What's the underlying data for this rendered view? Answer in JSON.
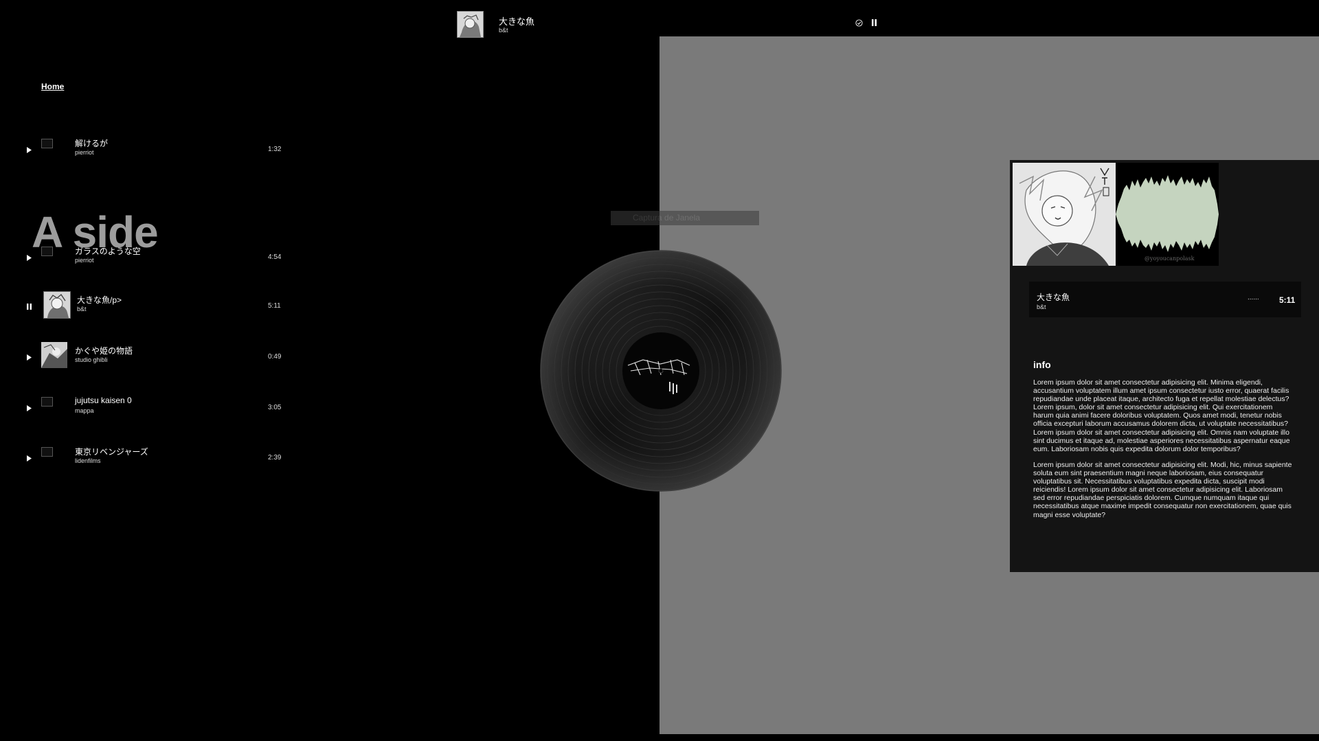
{
  "now_playing": {
    "title": "大きな魚",
    "artist": "b&t",
    "time": "5:11",
    "dots": "......"
  },
  "nav": {
    "home": "Home"
  },
  "side_heading": "A side",
  "tracks": [
    {
      "title": "解けるが",
      "artist": "pierriot",
      "duration": "1:32",
      "state": "paused",
      "cover": "broken"
    },
    {
      "title": "ガラスのような空",
      "artist": "pierriot",
      "duration": "4:54",
      "state": "paused",
      "cover": "broken"
    },
    {
      "title": "大きな魚/p>",
      "artist": "b&t",
      "duration": "5:11",
      "state": "playing",
      "cover": "sketch"
    },
    {
      "title": "かぐや姫の物語",
      "artist": "studio ghibli",
      "duration": "0:49",
      "state": "paused",
      "cover": "sketch"
    },
    {
      "title": "jujutsu kaisen 0",
      "artist": "mappa",
      "duration": "3:05",
      "state": "paused",
      "cover": "broken"
    },
    {
      "title": "東京リベンジャーズ",
      "artist": "lidenfilms",
      "duration": "2:39",
      "state": "paused",
      "cover": "broken"
    }
  ],
  "overlay": {
    "label": "Captura de Janela"
  },
  "panel": {
    "wave_caption": "@yoyoucanpolask",
    "info_heading": "info",
    "paragraphs": [
      "Lorem ipsum dolor sit amet consectetur adipisicing elit. Minima eligendi, accusantium voluptatem illum amet ipsum consectetur iusto error, quaerat facilis repudiandae unde placeat itaque, architecto fuga et repellat molestiae delectus? Lorem ipsum, dolor sit amet consectetur adipisicing elit. Qui exercitationem harum quia animi facere doloribus voluptatem. Quos amet modi, tenetur nobis officia excepturi laborum accusamus dolorem dicta, ut voluptate necessitatibus? Lorem ipsum dolor sit amet consectetur adipisicing elit. Omnis nam voluptate illo sint ducimus et itaque ad, molestiae asperiores necessitatibus aspernatur eaque eum. Laboriosam nobis quis expedita dolorum dolor temporibus?",
      "Lorem ipsum dolor sit amet consectetur adipisicing elit. Modi, hic, minus sapiente soluta eum sint praesentium magni neque laboriosam, eius consequatur voluptatibus sit. Necessitatibus voluptatibus expedita dicta, suscipit modi reiciendis! Lorem ipsum dolor sit amet consectetur adipisicing elit. Laboriosam sed error repudiandae perspiciatis dolorem. Cumque numquam itaque qui necessitatibus atque maxime impedit consequatur non exercitationem, quae quis magni esse voluptate?"
    ]
  },
  "colors": {
    "background": "#000000",
    "right_half": "#7a7a7a",
    "panel": "#141414",
    "waveform": "#c5d4bf",
    "heading_gray": "#9c9c9c"
  },
  "icons": {
    "play": "play-icon",
    "pause": "pause-icon",
    "check": "check-circle-icon"
  }
}
